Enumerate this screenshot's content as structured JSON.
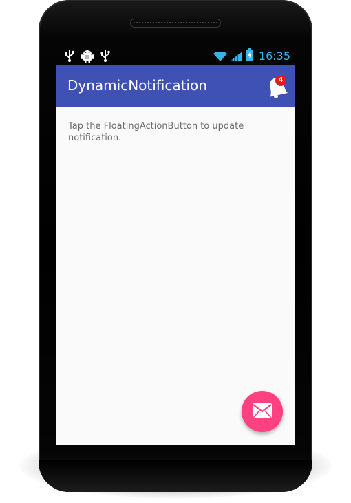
{
  "status_bar": {
    "left_icons": [
      "usb-icon",
      "android-debug-icon",
      "usb-icon"
    ],
    "right_icons": [
      "wifi-icon",
      "signal-icon",
      "battery-charging-icon"
    ],
    "time": "16:35",
    "color": "#33b5e5"
  },
  "app_bar": {
    "title": "DynamicNotification",
    "color": "#3f51b5",
    "notification_icon": "bell-icon",
    "badge_count": "4",
    "badge_color": "#e41b1b"
  },
  "content": {
    "message": "Tap the FloatingActionButton to update notification."
  },
  "fab": {
    "icon": "email-icon",
    "color": "#ff4081"
  }
}
